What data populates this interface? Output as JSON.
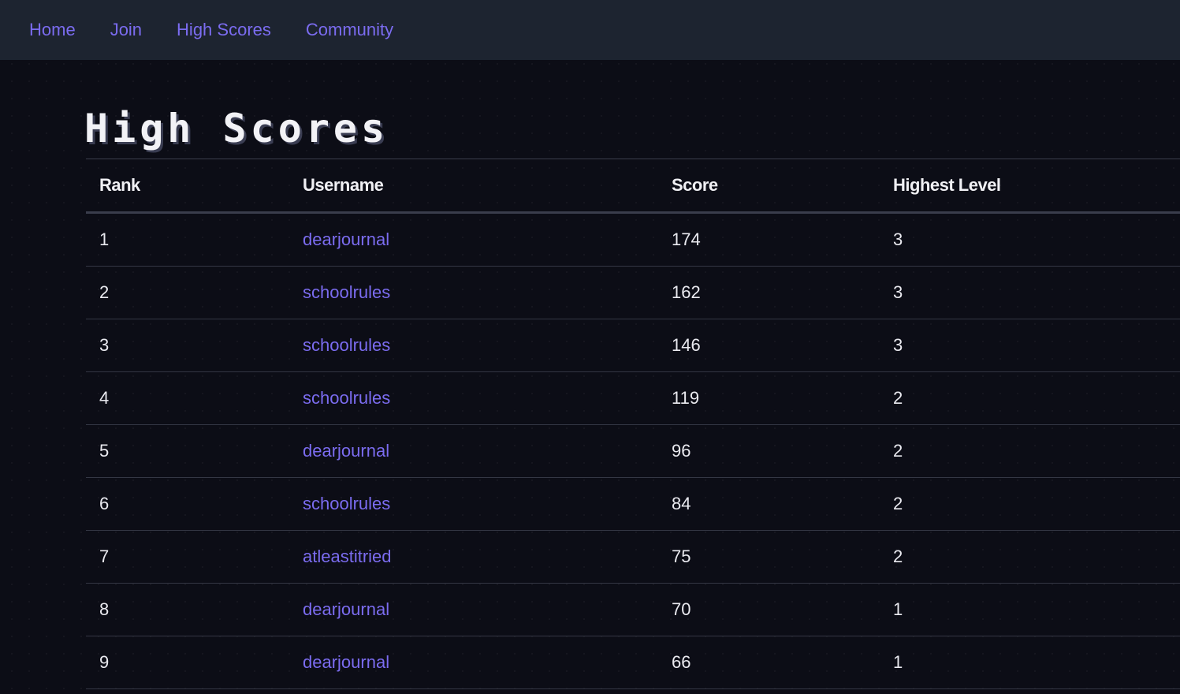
{
  "nav": {
    "items": [
      {
        "label": "Home"
      },
      {
        "label": "Join"
      },
      {
        "label": "High Scores"
      },
      {
        "label": "Community"
      }
    ]
  },
  "page": {
    "title": "High Scores"
  },
  "table": {
    "headers": [
      "Rank",
      "Username",
      "Score",
      "Highest Level"
    ],
    "rows": [
      {
        "rank": "1",
        "username": "dearjournal",
        "score": "174",
        "level": "3"
      },
      {
        "rank": "2",
        "username": "schoolrules",
        "score": "162",
        "level": "3"
      },
      {
        "rank": "3",
        "username": "schoolrules",
        "score": "146",
        "level": "3"
      },
      {
        "rank": "4",
        "username": "schoolrules",
        "score": "119",
        "level": "2"
      },
      {
        "rank": "5",
        "username": "dearjournal",
        "score": "96",
        "level": "2"
      },
      {
        "rank": "6",
        "username": "schoolrules",
        "score": "84",
        "level": "2"
      },
      {
        "rank": "7",
        "username": "atleastitried",
        "score": "75",
        "level": "2"
      },
      {
        "rank": "8",
        "username": "dearjournal",
        "score": "70",
        "level": "1"
      },
      {
        "rank": "9",
        "username": "dearjournal",
        "score": "66",
        "level": "1"
      }
    ]
  },
  "colors": {
    "accent": "#7b6cf0",
    "nav_background": "#1d2430",
    "page_background": "#0c0d16"
  }
}
